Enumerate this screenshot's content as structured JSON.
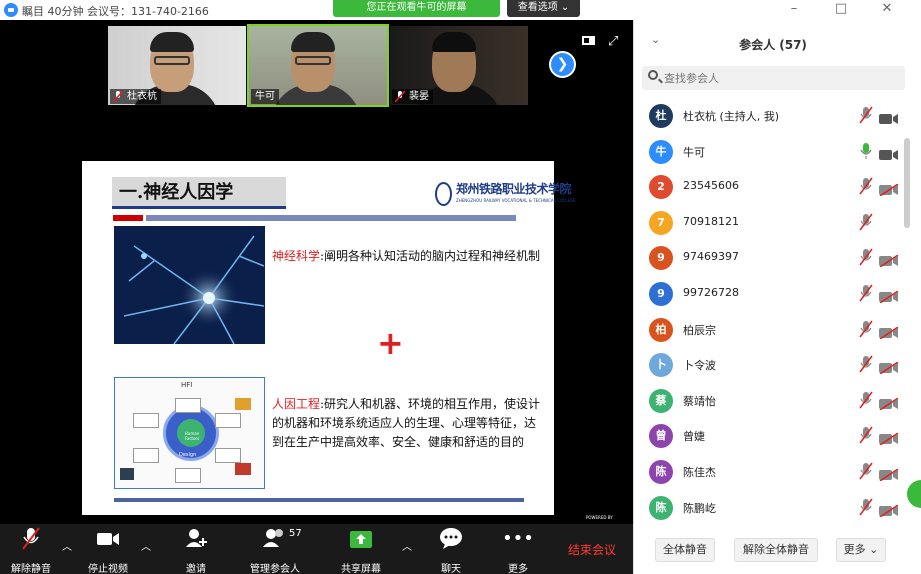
{
  "titlebar": {
    "title": "瞩目 40分钟 会议号：131-740-2166",
    "banner": "您正在观看牛可的屏幕",
    "view_options": "查看选项 ⌄"
  },
  "thumbnails": [
    {
      "name": "杜衣杭",
      "muted": true
    },
    {
      "name": "牛可",
      "muted": false,
      "active": true
    },
    {
      "name": "裴晏",
      "muted": true
    }
  ],
  "slide": {
    "title": "一.神经人因学",
    "logo_cn": "郑州铁路职业技术学院",
    "logo_en": "ZHENGZHOU RAILWAY VOCATIONAL & TECHNICAL COLLEGE",
    "p1_term": "神经科学",
    "p1_text": ":阐明各种认知活动的脑内过程和神经机制",
    "plus": "+",
    "hfi_label": "HFI",
    "hfi_concept": "Concept",
    "hfi_core": "Human Factors",
    "hfi_design": "Design",
    "p2_term": "人因工程",
    "p2_text": ":研究人和机器、环境的相互作用，使设计的机器和环境系统适应人的生理、心理等特征，达到在生产中提高效率、安全、健康和舒适的目的",
    "powered": "POWERED BY"
  },
  "toolbar": {
    "unmute": "解除静音",
    "stop_video": "停止视频",
    "invite": "邀请",
    "manage": "管理参会人",
    "participant_count": "57",
    "share": "共享屏幕",
    "chat": "聊天",
    "more": "更多",
    "end": "结束会议"
  },
  "panel": {
    "title": "参会人 (57)",
    "search_placeholder": "查找参会人",
    "participants": [
      {
        "avatar": "杜",
        "name": "杜衣杭 (主持人, 我)",
        "color": "#1f3a5f",
        "mic": "muted",
        "cam": "on"
      },
      {
        "avatar": "牛",
        "name": "牛可",
        "color": "#2d8cff",
        "mic": "on",
        "cam": "on"
      },
      {
        "avatar": "2",
        "name": "23545606",
        "color": "#e04a2f",
        "mic": "muted",
        "cam": "off"
      },
      {
        "avatar": "7",
        "name": "70918121",
        "color": "#f5a623",
        "mic": "muted",
        "cam": "none"
      },
      {
        "avatar": "9",
        "name": "97469397",
        "color": "#d9531e",
        "mic": "muted",
        "cam": "off"
      },
      {
        "avatar": "9",
        "name": "99726728",
        "color": "#2d6fd2",
        "mic": "muted",
        "cam": "off"
      },
      {
        "avatar": "柏",
        "name": "柏辰宗",
        "color": "#d9531e",
        "mic": "muted",
        "cam": "off"
      },
      {
        "avatar": "卜",
        "name": "卜令波",
        "color": "#6fa8dc",
        "mic": "muted",
        "cam": "off"
      },
      {
        "avatar": "蔡",
        "name": "蔡靖怡",
        "color": "#3cb371",
        "mic": "muted",
        "cam": "off"
      },
      {
        "avatar": "曾",
        "name": "曾婕",
        "color": "#8e44ad",
        "mic": "muted",
        "cam": "off"
      },
      {
        "avatar": "陈",
        "name": "陈佳杰",
        "color": "#8e44ad",
        "mic": "muted",
        "cam": "off"
      },
      {
        "avatar": "陈",
        "name": "陈鹏屹",
        "color": "#3cb371",
        "mic": "muted",
        "cam": "off"
      }
    ],
    "mute_all": "全体静音",
    "unmute_all": "解除全体静音",
    "more": "更多 ⌄"
  }
}
